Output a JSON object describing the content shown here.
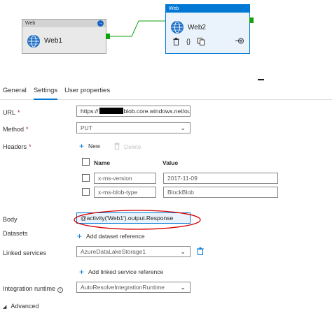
{
  "pipeline": {
    "activity1": {
      "type": "Web",
      "name": "Web1"
    },
    "activity2": {
      "type": "Web",
      "name": "Web2"
    },
    "colors": {
      "selected": "#0078d4",
      "port": "#13a10e",
      "connector": "#13a10e"
    }
  },
  "tabs": [
    {
      "label": "General",
      "active": false
    },
    {
      "label": "Settings",
      "active": true
    },
    {
      "label": "User properties",
      "active": false
    }
  ],
  "settings": {
    "url": {
      "label": "URL",
      "value_prefix": "https://",
      "value_suffix": "blob.core.windows.net/out"
    },
    "method": {
      "label": "Method",
      "value": "PUT"
    },
    "headers": {
      "label": "Headers",
      "new_label": "New",
      "delete_label": "Delete",
      "columns": [
        "Name",
        "Value"
      ],
      "rows": [
        {
          "name": "x-ms-version",
          "value": "2017-11-09"
        },
        {
          "name": "x-ms-blob-type",
          "value": "BlockBlob"
        }
      ]
    },
    "body": {
      "label": "Body",
      "value": "@activity('Web1').output.Response"
    },
    "datasets": {
      "label": "Datasets",
      "add_label": "Add dataset reference"
    },
    "linked_services": {
      "label": "Linked services",
      "value": "AzureDataLakeStorage1",
      "add_label": "Add linked service reference"
    },
    "integration_runtime": {
      "label": "Integration runtime",
      "value": "AutoResolveIntegrationRuntime"
    },
    "advanced": {
      "label": "Advanced"
    }
  }
}
